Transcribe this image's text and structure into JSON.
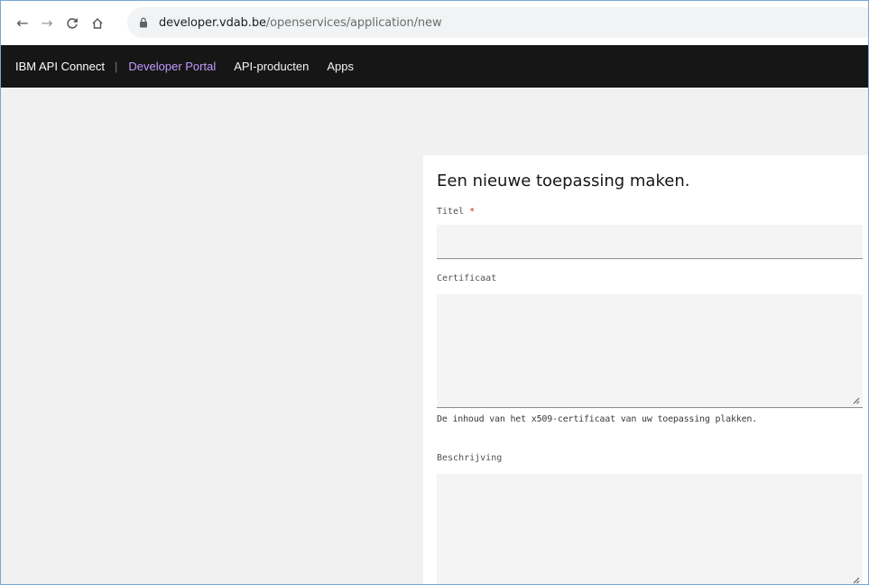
{
  "browser": {
    "url_host": "developer.vdab.be",
    "url_path": "/openservices/application/new",
    "icons": [
      "back-arrow-icon",
      "forward-arrow-icon",
      "reload-icon",
      "home-icon",
      "lock-icon"
    ]
  },
  "header": {
    "brand": "IBM API Connect",
    "separator": "|",
    "portal": "Developer Portal",
    "nav": [
      "API-producten",
      "Apps"
    ]
  },
  "form": {
    "title": "Een nieuwe toepassing maken.",
    "fields": {
      "titel": {
        "label": "Titel",
        "required_mark": "*",
        "value": ""
      },
      "certificaat": {
        "label": "Certificaat",
        "value": "",
        "helper": "De inhoud van het x509-certificaat van uw toepassing plakken."
      },
      "beschrijving": {
        "label": "Beschrijving",
        "value": ""
      }
    }
  },
  "colors": {
    "header_bg": "#161616",
    "portal_accent": "#c49bff",
    "page_bg": "#f1f1f1",
    "required": "#da1e28"
  }
}
